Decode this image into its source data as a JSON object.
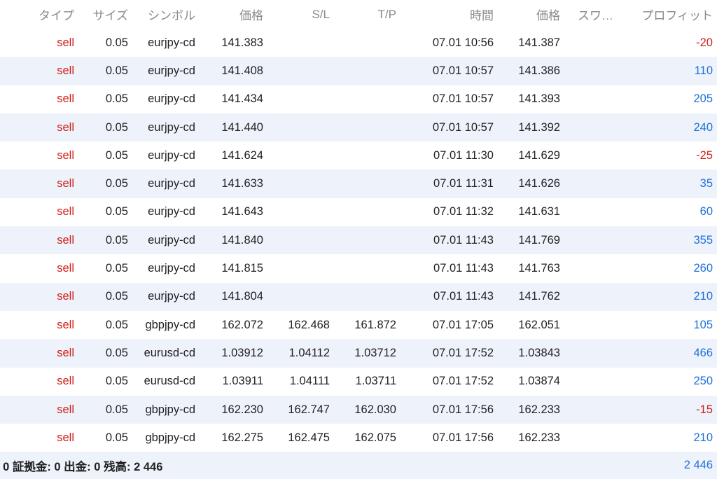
{
  "columns": {
    "type": "タイプ",
    "size": "サイズ",
    "symbol": "シンボル",
    "open_price": "価格",
    "sl": "S/L",
    "tp": "T/P",
    "time": "時間",
    "close_price": "価格",
    "swap": "スワ…",
    "profit": "プロフィット"
  },
  "rows": [
    {
      "type": "sell",
      "size": "0.05",
      "symbol": "eurjpy-cd",
      "open_price": "141.383",
      "sl": "",
      "tp": "",
      "time": "07.01 10:56",
      "close_price": "141.387",
      "profit": "-20",
      "sign": "neg"
    },
    {
      "type": "sell",
      "size": "0.05",
      "symbol": "eurjpy-cd",
      "open_price": "141.408",
      "sl": "",
      "tp": "",
      "time": "07.01 10:57",
      "close_price": "141.386",
      "profit": "110",
      "sign": "pos"
    },
    {
      "type": "sell",
      "size": "0.05",
      "symbol": "eurjpy-cd",
      "open_price": "141.434",
      "sl": "",
      "tp": "",
      "time": "07.01 10:57",
      "close_price": "141.393",
      "profit": "205",
      "sign": "pos"
    },
    {
      "type": "sell",
      "size": "0.05",
      "symbol": "eurjpy-cd",
      "open_price": "141.440",
      "sl": "",
      "tp": "",
      "time": "07.01 10:57",
      "close_price": "141.392",
      "profit": "240",
      "sign": "pos"
    },
    {
      "type": "sell",
      "size": "0.05",
      "symbol": "eurjpy-cd",
      "open_price": "141.624",
      "sl": "",
      "tp": "",
      "time": "07.01 11:30",
      "close_price": "141.629",
      "profit": "-25",
      "sign": "neg"
    },
    {
      "type": "sell",
      "size": "0.05",
      "symbol": "eurjpy-cd",
      "open_price": "141.633",
      "sl": "",
      "tp": "",
      "time": "07.01 11:31",
      "close_price": "141.626",
      "profit": "35",
      "sign": "pos"
    },
    {
      "type": "sell",
      "size": "0.05",
      "symbol": "eurjpy-cd",
      "open_price": "141.643",
      "sl": "",
      "tp": "",
      "time": "07.01 11:32",
      "close_price": "141.631",
      "profit": "60",
      "sign": "pos"
    },
    {
      "type": "sell",
      "size": "0.05",
      "symbol": "eurjpy-cd",
      "open_price": "141.840",
      "sl": "",
      "tp": "",
      "time": "07.01 11:43",
      "close_price": "141.769",
      "profit": "355",
      "sign": "pos"
    },
    {
      "type": "sell",
      "size": "0.05",
      "symbol": "eurjpy-cd",
      "open_price": "141.815",
      "sl": "",
      "tp": "",
      "time": "07.01 11:43",
      "close_price": "141.763",
      "profit": "260",
      "sign": "pos"
    },
    {
      "type": "sell",
      "size": "0.05",
      "symbol": "eurjpy-cd",
      "open_price": "141.804",
      "sl": "",
      "tp": "",
      "time": "07.01 11:43",
      "close_price": "141.762",
      "profit": "210",
      "sign": "pos"
    },
    {
      "type": "sell",
      "size": "0.05",
      "symbol": "gbpjpy-cd",
      "open_price": "162.072",
      "sl": "162.468",
      "tp": "161.872",
      "time": "07.01 17:05",
      "close_price": "162.051",
      "profit": "105",
      "sign": "pos"
    },
    {
      "type": "sell",
      "size": "0.05",
      "symbol": "eurusd-cd",
      "open_price": "1.03912",
      "sl": "1.04112",
      "tp": "1.03712",
      "time": "07.01 17:52",
      "close_price": "1.03843",
      "profit": "466",
      "sign": "pos"
    },
    {
      "type": "sell",
      "size": "0.05",
      "symbol": "eurusd-cd",
      "open_price": "1.03911",
      "sl": "1.04111",
      "tp": "1.03711",
      "time": "07.01 17:52",
      "close_price": "1.03874",
      "profit": "250",
      "sign": "pos"
    },
    {
      "type": "sell",
      "size": "0.05",
      "symbol": "gbpjpy-cd",
      "open_price": "162.230",
      "sl": "162.747",
      "tp": "162.030",
      "time": "07.01 17:56",
      "close_price": "162.233",
      "profit": "-15",
      "sign": "neg"
    },
    {
      "type": "sell",
      "size": "0.05",
      "symbol": "gbpjpy-cd",
      "open_price": "162.275",
      "sl": "162.475",
      "tp": "162.075",
      "time": "07.01 17:56",
      "close_price": "162.233",
      "profit": "210",
      "sign": "pos"
    }
  ],
  "footer": {
    "summary": ": 0 証拠金: 0 出金: 0 残高: 2 446",
    "total": "2 446"
  },
  "colors": {
    "sell": "#d0201a",
    "negative": "#d0201a",
    "positive": "#1e6fd9",
    "row_alt": "#eef3fb",
    "header_text": "#8a8a8a"
  }
}
